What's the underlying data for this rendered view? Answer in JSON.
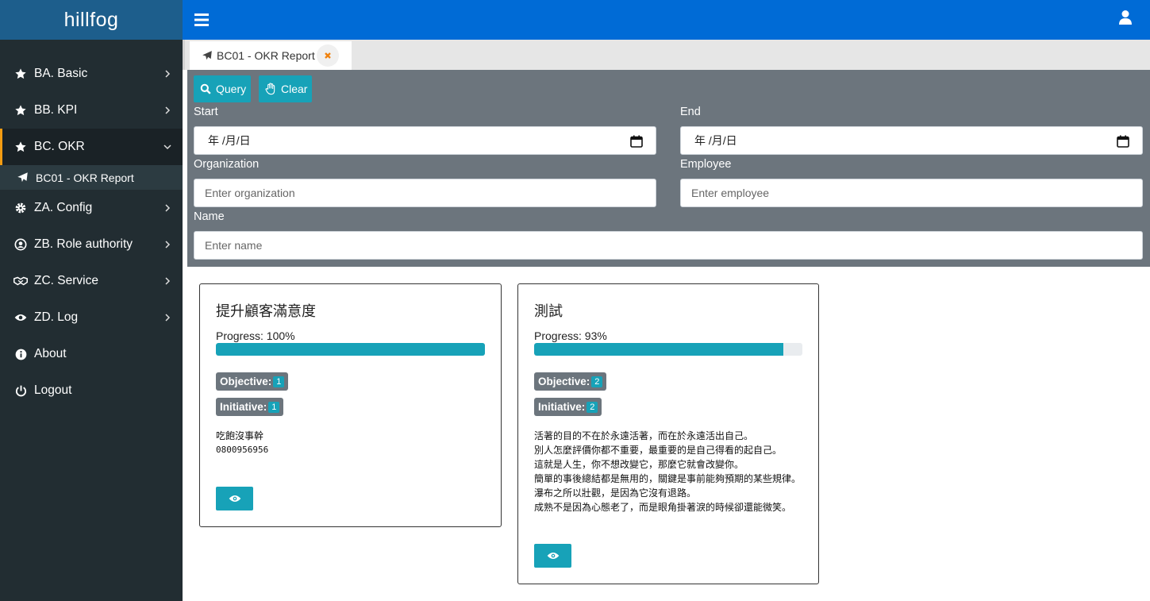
{
  "app": {
    "brand": "hillfog"
  },
  "sidebar": {
    "items": [
      {
        "label": "BA. Basic",
        "icon": "star-icon"
      },
      {
        "label": "BB. KPI",
        "icon": "star-icon"
      },
      {
        "label": "BC. OKR",
        "icon": "star-icon",
        "expanded": true
      },
      {
        "label": "ZA. Config",
        "icon": "gear-icon"
      },
      {
        "label": "ZB. Role authority",
        "icon": "user-circle-icon"
      },
      {
        "label": "ZC. Service",
        "icon": "handshake-icon"
      },
      {
        "label": "ZD. Log",
        "icon": "eye-icon"
      },
      {
        "label": "About",
        "icon": "info-icon"
      },
      {
        "label": "Logout",
        "icon": "power-icon"
      }
    ],
    "subitem": {
      "label": "BC01 - OKR Report",
      "icon": "paper-plane-icon"
    }
  },
  "tabs": {
    "active": {
      "label": "BC01 - OKR Report",
      "icon": "paper-plane-icon"
    }
  },
  "query": {
    "query_label": "Query",
    "clear_label": "Clear",
    "start_label": "Start",
    "end_label": "End",
    "date_placeholder": "年 /月/日",
    "organization_label": "Organization",
    "organization_placeholder": "Enter organization",
    "employee_label": "Employee",
    "employee_placeholder": "Enter employee",
    "name_label": "Name",
    "name_placeholder": "Enter name"
  },
  "cards": [
    {
      "title": "提升顧客滿意度",
      "progress_text": "Progress: 100%",
      "progress": 1.0,
      "objective_label": "Objective:",
      "objective_count": "1",
      "initiative_label": "Initiative:",
      "initiative_count": "1",
      "description": [
        "吃飽沒事幹"
      ],
      "phone": "0800956956"
    },
    {
      "title": "測試",
      "progress_text": "Progress: 93%",
      "progress": 0.93,
      "objective_label": "Objective:",
      "objective_count": "2",
      "initiative_label": "Initiative:",
      "initiative_count": "2",
      "description": [
        "活著的目的不在於永遠活著，而在於永遠活出自己。",
        "別人怎麼評價你都不重要，最重要的是自己得看的起自己。",
        "這就是人生，你不想改變它，那麼它就會改變你。",
        "簡單的事後總結都是無用的，關鍵是事前能夠預期的某些規律。",
        "瀑布之所以壯觀，是因為它沒有退路。",
        "成熟不是因為心態老了，而是眼角掛著淚的時候卻還能微笑。"
      ]
    }
  ],
  "colors": {
    "accent": "#17a2b8",
    "topbar": "#006bd6",
    "sidebar": "#222d32",
    "brand": "#1d5e8c",
    "active_marker": "#f39c12",
    "panel": "#6c757d"
  }
}
